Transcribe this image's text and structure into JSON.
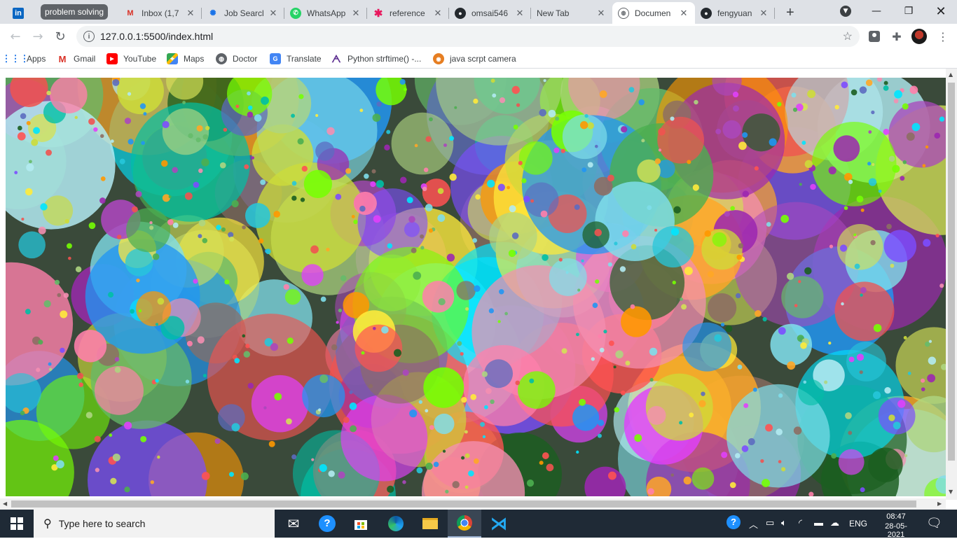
{
  "tabs": {
    "group_label": "problem solving",
    "items": [
      {
        "label": "Inbox (1,7",
        "icon": "gmail-icon"
      },
      {
        "label": "Job Searcl",
        "icon": "lightbulb-icon"
      },
      {
        "label": "WhatsApp",
        "icon": "whatsapp-icon"
      },
      {
        "label": "reference",
        "icon": "asterisk-icon"
      },
      {
        "label": "omsai546",
        "icon": "github-icon"
      },
      {
        "label": "New Tab",
        "icon": ""
      },
      {
        "label": "Documen",
        "icon": "globe-icon"
      },
      {
        "label": "fengyuan",
        "icon": "github-icon"
      }
    ]
  },
  "toolbar": {
    "url": "127.0.0.1:5500/index.html"
  },
  "bookmarks": [
    {
      "label": "Apps",
      "icon": "apps-grid-icon"
    },
    {
      "label": "Gmail",
      "icon": "gmail-icon"
    },
    {
      "label": "YouTube",
      "icon": "youtube-icon"
    },
    {
      "label": "Maps",
      "icon": "maps-icon"
    },
    {
      "label": "Doctor",
      "icon": "globe-icon"
    },
    {
      "label": "Translate",
      "icon": "translate-icon"
    },
    {
      "label": "Python strftime() -...",
      "icon": "python-icon"
    },
    {
      "label": "java scrpt camera",
      "icon": "camera-site-icon"
    }
  ],
  "taskbar": {
    "search_placeholder": "Type here to search",
    "language": "ENG",
    "time": "08:47",
    "date": "28-05-2021"
  },
  "colors": {
    "tabstrip": "#dee1e6",
    "taskbar": "#1f2a36",
    "group_chip": "#5f6368"
  }
}
